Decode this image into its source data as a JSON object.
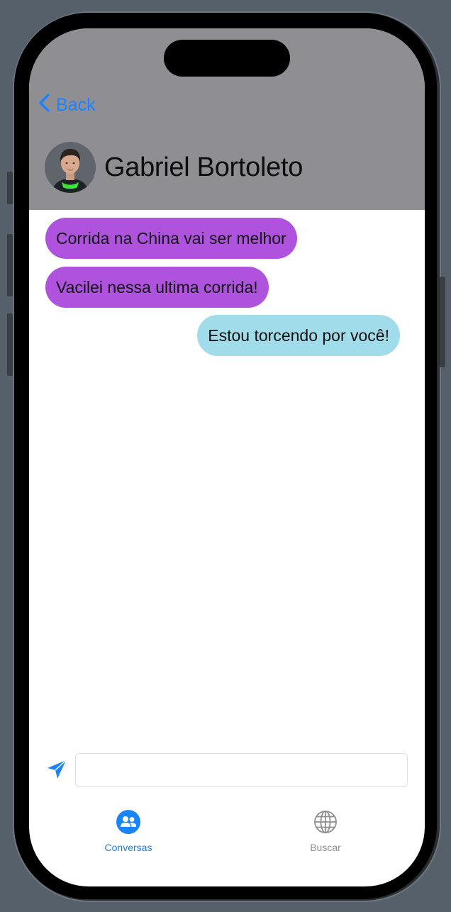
{
  "header": {
    "back_label": "Back",
    "contact_name": "Gabriel Bortoleto"
  },
  "messages": [
    {
      "direction": "received",
      "text": "Corrida na China vai ser melhor"
    },
    {
      "direction": "received",
      "text": "Vacilei nessa ultima corrida!"
    },
    {
      "direction": "sent",
      "text": "Estou torcendo por você!"
    }
  ],
  "composer": {
    "input_value": "",
    "send_icon": "paper-plane-icon"
  },
  "tabbar": {
    "tabs": [
      {
        "label": "Conversas",
        "icon": "people-icon",
        "active": true
      },
      {
        "label": "Buscar",
        "icon": "globe-icon",
        "active": false
      }
    ]
  },
  "colors": {
    "header_bg": "#8e8e93",
    "accent": "#1a84ff",
    "received_bubble": "#af52de",
    "sent_bubble": "#a1dcea"
  }
}
